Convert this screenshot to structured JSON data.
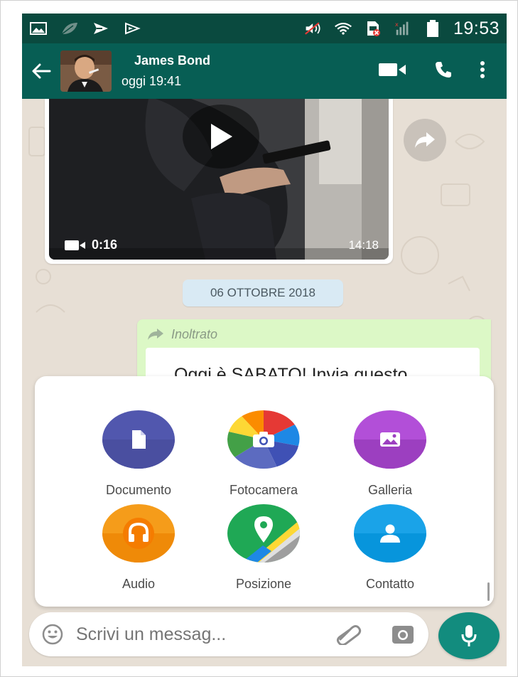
{
  "status_bar": {
    "time": "19:53",
    "left_icons": [
      "image-notification-icon",
      "leaf-notification-icon",
      "send-notification-icon",
      "play-notification-icon"
    ],
    "right_icons": [
      "mute-icon",
      "wifi-icon",
      "sim-blocked-icon",
      "signal-icon",
      "battery-icon"
    ]
  },
  "header": {
    "contact_name": "James Bond",
    "last_seen": "oggi 19:41",
    "actions": [
      "video-call-icon",
      "phone-call-icon",
      "more-options-icon"
    ]
  },
  "video_message": {
    "duration": "0:16",
    "time": "14:18"
  },
  "date_separator": "06 OTTOBRE 2018",
  "forwarded_message": {
    "label": "Inoltrato",
    "text": "Oggi è SABATO! Invia questo"
  },
  "attach_menu": {
    "items": [
      {
        "label": "Documento",
        "icon": "document-icon",
        "color": "#5157ae"
      },
      {
        "label": "Fotocamera",
        "icon": "camera-icon",
        "color": "#ec407a"
      },
      {
        "label": "Galleria",
        "icon": "gallery-icon",
        "color": "#ac44cf"
      },
      {
        "label": "Audio",
        "icon": "headphones-icon",
        "color": "#f57c00"
      },
      {
        "label": "Posizione",
        "icon": "location-pin-icon",
        "color": "#1fa855"
      },
      {
        "label": "Contatto",
        "icon": "contact-icon",
        "color": "#0795dc"
      }
    ]
  },
  "composer": {
    "placeholder": "Scrivi un messag..."
  },
  "colors": {
    "header": "#075e54",
    "status_bar": "#0a4a3f",
    "outgoing_bubble": "#dcf8c6",
    "mic_button": "#128c7e"
  }
}
